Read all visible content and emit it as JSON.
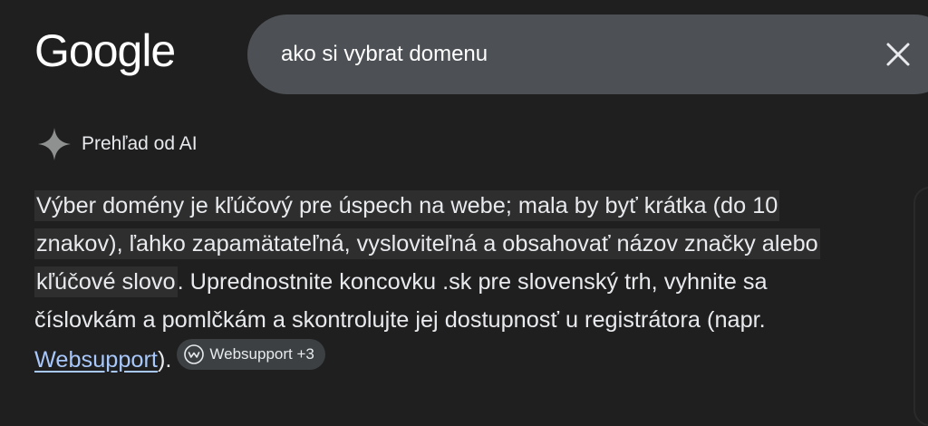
{
  "header": {
    "logo_text": "Google",
    "search_query": "ako si vybrat domenu",
    "clear_icon": "close-icon"
  },
  "ai_overview": {
    "icon": "sparkle-icon",
    "label": "Prehľad od AI",
    "text": {
      "highlight_1": "Výber domény je kľúčový pre úspech na webe; mala by byť krátka (do 10 znakov), ľahko zapamätateľná, vysloviteľná a obsahovať názov značky alebo kľúčové slovo",
      "rest": ". Uprednostnite koncovku .sk pre slovenský trh, vyhnite sa číslovkám a pomlčkám a skontrolujte jej dostupnosť u registrátora (napr. ",
      "link": "Websupport",
      "end": ")."
    },
    "source_chip": {
      "icon": "websupport-icon",
      "label": "Websupport +3"
    }
  },
  "colors": {
    "background": "#1f1f1f",
    "search_box": "#4d5156",
    "highlight": "#2e2e2e",
    "link": "#a8c7fa",
    "chip": "#3c4043"
  }
}
